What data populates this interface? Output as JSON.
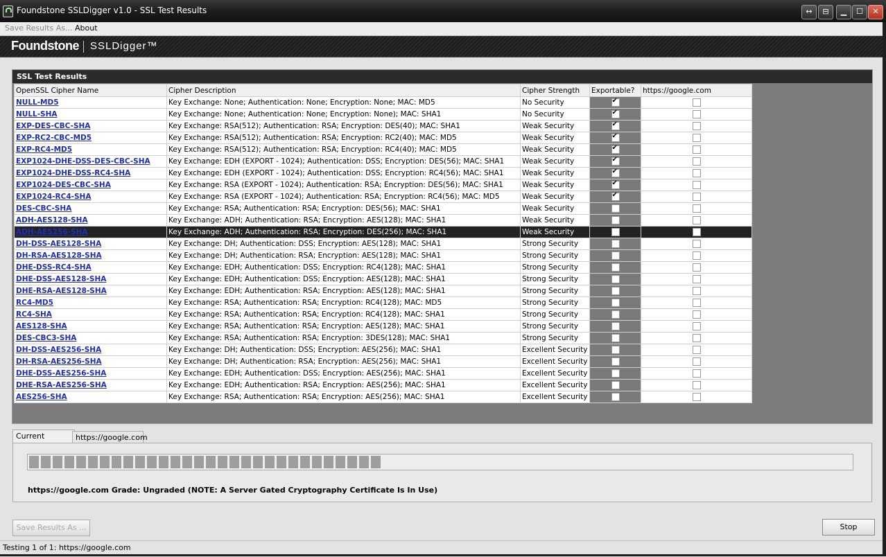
{
  "window": {
    "title": "Foundstone SSLDigger v1.0 - SSL Test Results"
  },
  "titlebar_buttons": {
    "restore": "↔",
    "pin": "⊟",
    "minimize": "▁",
    "maximize": "☐",
    "close": "✕"
  },
  "menu": {
    "save": "Save Results As...",
    "about": "About"
  },
  "banner": {
    "brand": "Foundstone",
    "product": "SSLDigger™"
  },
  "results": {
    "title": "SSL Test Results",
    "columns": [
      "OpenSSL Cipher Name",
      "Cipher Description",
      "Cipher Strength",
      "Exportable?",
      "https://google.com"
    ],
    "rows": [
      {
        "name": "NULL-MD5",
        "desc": "Key Exchange: None; Authentication: None; Encryption: None; MAC: MD5",
        "strength": "No Security",
        "exportable": true,
        "google": false
      },
      {
        "name": "NULL-SHA",
        "desc": "Key Exchange: None; Authentication: None; Encryption: None); MAC: SHA1",
        "strength": "No Security",
        "exportable": true,
        "google": false
      },
      {
        "name": "EXP-DES-CBC-SHA",
        "desc": "Key Exchange: RSA(512); Authentication: RSA; Encryption: DES(40); MAC: SHA1",
        "strength": "Weak Security",
        "exportable": true,
        "google": false
      },
      {
        "name": "EXP-RC2-CBC-MD5",
        "desc": "Key Exchange: RSA(512); Authentication: RSA; Encryption: RC2(40); MAC: MD5",
        "strength": "Weak Security",
        "exportable": true,
        "google": false
      },
      {
        "name": "EXP-RC4-MD5",
        "desc": "Key Exchange: RSA(512); Authentication: RSA; Encryption: RC4(40); MAC: MD5",
        "strength": "Weak Security",
        "exportable": true,
        "google": false
      },
      {
        "name": "EXP1024-DHE-DSS-DES-CBC-SHA",
        "desc": "Key Exchange: EDH (EXPORT - 1024); Authentication: DSS; Encryption: DES(56); MAC: SHA1",
        "strength": "Weak Security",
        "exportable": true,
        "google": false
      },
      {
        "name": "EXP1024-DHE-DSS-RC4-SHA",
        "desc": "Key Exchange: EDH (EXPORT - 1024); Authentication: DSS; Encryption: RC4(56); MAC: SHA1",
        "strength": "Weak Security",
        "exportable": true,
        "google": false
      },
      {
        "name": "EXP1024-DES-CBC-SHA",
        "desc": "Key Exchange: RSA (EXPORT - 1024); Authentication: RSA; Encryption: DES(56); MAC: SHA1",
        "strength": "Weak Security",
        "exportable": true,
        "google": false
      },
      {
        "name": "EXP1024-RC4-SHA",
        "desc": "Key Exchange: RSA (EXPORT - 1024); Authentication: RSA; Encryption: RC4(56); MAC: MD5",
        "strength": "Weak Security",
        "exportable": true,
        "google": false
      },
      {
        "name": "DES-CBC-SHA",
        "desc": "Key Exchange: RSA; Authentication: RSA; Encryption: DES(56); MAC: SHA1",
        "strength": "Weak Security",
        "exportable": false,
        "google": false
      },
      {
        "name": "ADH-AES128-SHA",
        "desc": "Key Exchange: ADH; Authentication: RSA; Encryption: AES(128); MAC: SHA1",
        "strength": "Weak Security",
        "exportable": false,
        "google": false
      },
      {
        "name": "ADH-AES256-SHA",
        "desc": "Key Exchange: ADH; Authentication: RSA; Encryption: DES(256); MAC: SHA1",
        "strength": "Weak Security",
        "exportable": false,
        "google": false,
        "selected": true
      },
      {
        "name": "DH-DSS-AES128-SHA",
        "desc": "Key Exchange: DH; Authentication: DSS; Encryption: AES(128); MAC: SHA1",
        "strength": "Strong Security",
        "exportable": false,
        "google": false
      },
      {
        "name": "DH-RSA-AES128-SHA",
        "desc": "Key Exchange: DH; Authentication: RSA; Encryption: AES(128); MAC: SHA1",
        "strength": "Strong Security",
        "exportable": false,
        "google": false
      },
      {
        "name": "DHE-DSS-RC4-SHA",
        "desc": "Key Exchange: EDH; Authentication: DSS; Encryption: RC4(128); MAC: SHA1",
        "strength": "Strong Security",
        "exportable": false,
        "google": false
      },
      {
        "name": "DHE-DSS-AES128-SHA",
        "desc": "Key Exchange: EDH; Authentication: DSS; Encryption: AES(128); MAC: SHA1",
        "strength": "Strong Security",
        "exportable": false,
        "google": false
      },
      {
        "name": "DHE-RSA-AES128-SHA",
        "desc": "Key Exchange: EDH; Authentication: RSA; Encryption: AES(128); MAC: SHA1",
        "strength": "Strong Security",
        "exportable": false,
        "google": false
      },
      {
        "name": "RC4-MD5",
        "desc": "Key Exchange: RSA; Authentication: RSA; Encryption: RC4(128); MAC: MD5",
        "strength": "Strong Security",
        "exportable": false,
        "google": false
      },
      {
        "name": "RC4-SHA",
        "desc": "Key Exchange: RSA; Authentication: RSA; Encryption: RC4(128); MAC: SHA1",
        "strength": "Strong Security",
        "exportable": false,
        "google": false
      },
      {
        "name": "AES128-SHA",
        "desc": "Key Exchange: RSA; Authentication: RSA; Encryption: AES(128); MAC: SHA1",
        "strength": "Strong Security",
        "exportable": false,
        "google": false
      },
      {
        "name": "DES-CBC3-SHA",
        "desc": "Key Exchange: RSA; Authentication: RSA; Encryption: 3DES(128); MAC: SHA1",
        "strength": "Strong Security",
        "exportable": false,
        "google": false
      },
      {
        "name": "DH-DSS-AES256-SHA",
        "desc": "Key Exchange: DH; Authentication: DSS; Encryption: AES(256); MAC: SHA1",
        "strength": "Excellent Security",
        "exportable": false,
        "google": false
      },
      {
        "name": "DH-RSA-AES256-SHA",
        "desc": "Key Exchange: DH; Authentication: RSA; Encryption: AES(256); MAC: SHA1",
        "strength": "Excellent Security",
        "exportable": false,
        "google": false
      },
      {
        "name": "DHE-DSS-AES256-SHA",
        "desc": "Key Exchange: EDH; Authentication: DSS; Encryption: AES(256); MAC: SHA1",
        "strength": "Excellent Security",
        "exportable": false,
        "google": false
      },
      {
        "name": "DHE-RSA-AES256-SHA",
        "desc": "Key Exchange: EDH; Authentication: RSA; Encryption: AES(256); MAC: SHA1",
        "strength": "Excellent Security",
        "exportable": false,
        "google": false
      },
      {
        "name": "AES256-SHA",
        "desc": "Key Exchange: RSA; Authentication: RSA; Encryption: AES(256); MAC: SHA1",
        "strength": "Excellent Security",
        "exportable": false,
        "google": false
      }
    ]
  },
  "tabs": [
    {
      "label": "Current Results",
      "active": true
    },
    {
      "label": "https://google.com",
      "active": false
    }
  ],
  "progress": {
    "filled_blocks": 30
  },
  "grade_text": "https://google.com Grade: Ungraded (NOTE: A Server Gated Cryptography Certificate Is In Use)",
  "buttons": {
    "save_results": "Save Results As ...",
    "stop": "Stop"
  },
  "status": "Testing 1 of 1: https://google.com",
  "colors": {
    "link": "#1f2fb0",
    "selected_row": "#222222",
    "exportable_bg": "#7a7a7a"
  }
}
